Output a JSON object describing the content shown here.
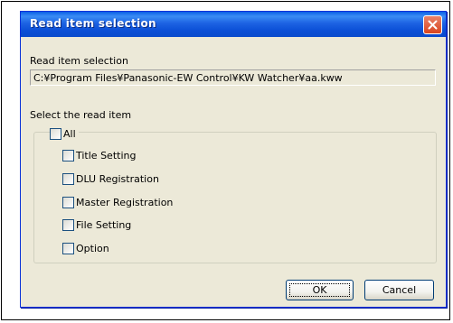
{
  "window": {
    "title": "Read item selection"
  },
  "read_item_selection": {
    "label": "Read item selection",
    "path": "C:¥Program Files¥Panasonic-EW Control¥KW Watcher¥aa.kww"
  },
  "select_read_item": {
    "label": "Select the read item",
    "checkboxes": [
      {
        "label": "All",
        "checked": false
      },
      {
        "label": "Title Setting",
        "checked": false
      },
      {
        "label": "DLU Registration",
        "checked": false
      },
      {
        "label": "Master Registration",
        "checked": false
      },
      {
        "label": "File Setting",
        "checked": false
      },
      {
        "label": "Option",
        "checked": false
      }
    ]
  },
  "buttons": {
    "ok": "OK",
    "cancel": "Cancel"
  },
  "icons": {
    "close": "close-icon"
  },
  "colors": {
    "titlebar": "#0b4fd6",
    "dialog_bg": "#ece9d8",
    "close_button": "#d9451f"
  }
}
